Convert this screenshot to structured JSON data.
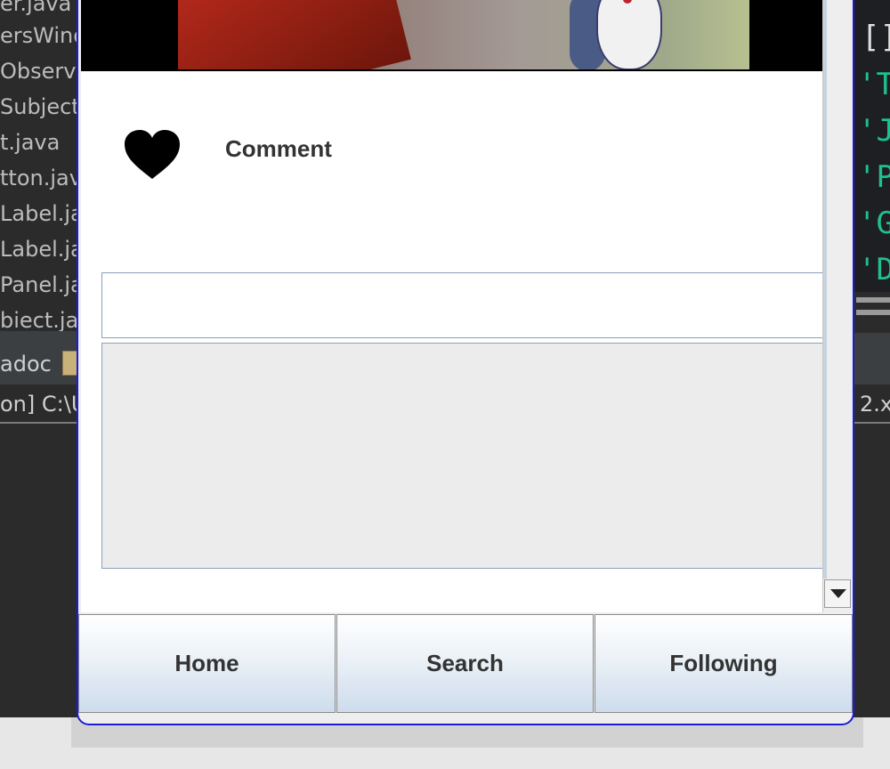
{
  "background_ide": {
    "files": [
      "er.java",
      "ersWindow",
      "Observer",
      "Subject",
      "t.java",
      "tton.java",
      "Label.java",
      "Label.java",
      "Panel.java",
      "biect.java"
    ],
    "tab_text": "adoc",
    "console_text": "on] C:\\U",
    "code_top": "[]",
    "code_lines": [
      "'To",
      "'Ja",
      "'Pr",
      "'Gu",
      "'Da"
    ],
    "right_console_text": "2.x"
  },
  "icons": {
    "like": "heart-icon",
    "scroll_down": "triangle-down-icon"
  },
  "colors": {
    "window_border": "#1c1cd9",
    "code_string": "#1fc08e",
    "ide_bg": "#2b2b2b"
  },
  "post": {
    "comment_label": "Comment",
    "comment_input_value": "",
    "comments_text": ""
  },
  "nav": {
    "home": "Home",
    "search": "Search",
    "following": "Following"
  }
}
